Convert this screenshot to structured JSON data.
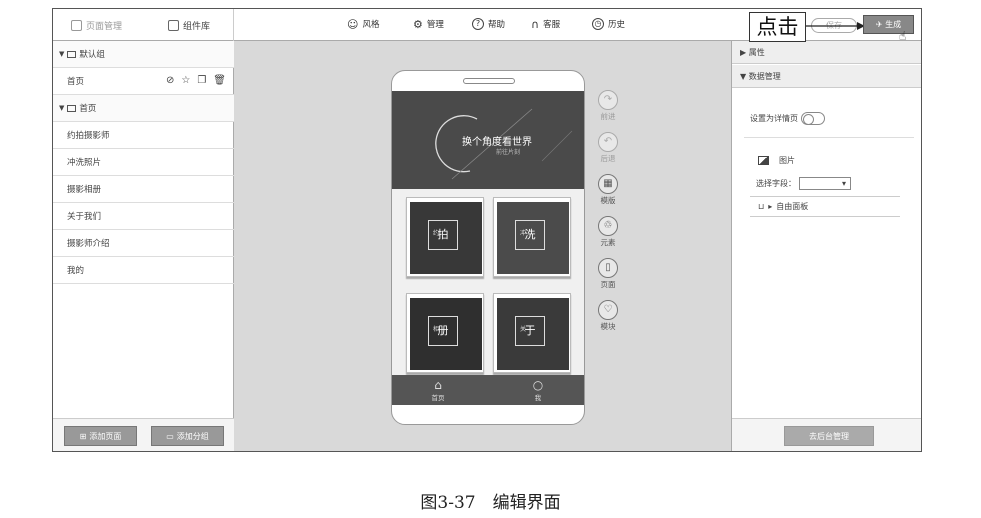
{
  "top_bar": {
    "left_tabs": [
      {
        "label": "页面管理",
        "icon": "page-icon"
      },
      {
        "label": "组件库",
        "icon": "component-icon"
      }
    ],
    "menu": [
      {
        "label": "风格",
        "icon": "style-icon"
      },
      {
        "label": "管理",
        "icon": "gear-icon"
      },
      {
        "label": "帮助",
        "icon": "help-icon"
      },
      {
        "label": "客服",
        "icon": "headset-icon"
      },
      {
        "label": "历史",
        "icon": "clock-icon"
      }
    ],
    "callout_text": "点击",
    "save_label": "保存",
    "generate_label": "生成"
  },
  "left_panel": {
    "groups": [
      {
        "label": "默认组",
        "pages": [
          {
            "label": "首页",
            "has_actions": true
          }
        ]
      },
      {
        "label": "首页",
        "pages": [
          {
            "label": "约拍摄影师"
          },
          {
            "label": "冲洗照片"
          },
          {
            "label": "摄影相册"
          },
          {
            "label": "关于我们"
          },
          {
            "label": "摄影师介绍"
          },
          {
            "label": "我的"
          }
        ]
      }
    ],
    "add_page_label": "添加页面",
    "add_group_label": "添加分组"
  },
  "phone": {
    "banner_title": "换个角度看世界",
    "banner_subtitle": "前往片刻",
    "tiles": [
      {
        "label": "拍",
        "small": "约"
      },
      {
        "label": "洗",
        "small": "冲"
      },
      {
        "label": "册",
        "small": "相"
      },
      {
        "label": "于",
        "small": "关"
      }
    ],
    "nav": [
      {
        "label": "首页",
        "icon": "home-icon"
      },
      {
        "label": "我",
        "icon": "chat-icon"
      }
    ]
  },
  "side_tools": [
    {
      "label": "前进",
      "icon": "forward-icon",
      "enabled": false
    },
    {
      "label": "后退",
      "icon": "back-icon",
      "enabled": false
    },
    {
      "label": "模版",
      "icon": "template-icon",
      "enabled": true
    },
    {
      "label": "元素",
      "icon": "element-icon",
      "enabled": true
    },
    {
      "label": "页面",
      "icon": "page-icon",
      "enabled": true
    },
    {
      "label": "模块",
      "icon": "module-icon",
      "enabled": true
    }
  ],
  "right_panel": {
    "properties_label": "属性",
    "data_manage_label": "数据管理",
    "detail_page_label": "设置为详情页",
    "image_label": "图片",
    "select_field_label": "选择字段：",
    "free_panel_label": "自由面板",
    "backend_button_label": "去后台管理"
  },
  "caption": "图3-37　编辑界面"
}
